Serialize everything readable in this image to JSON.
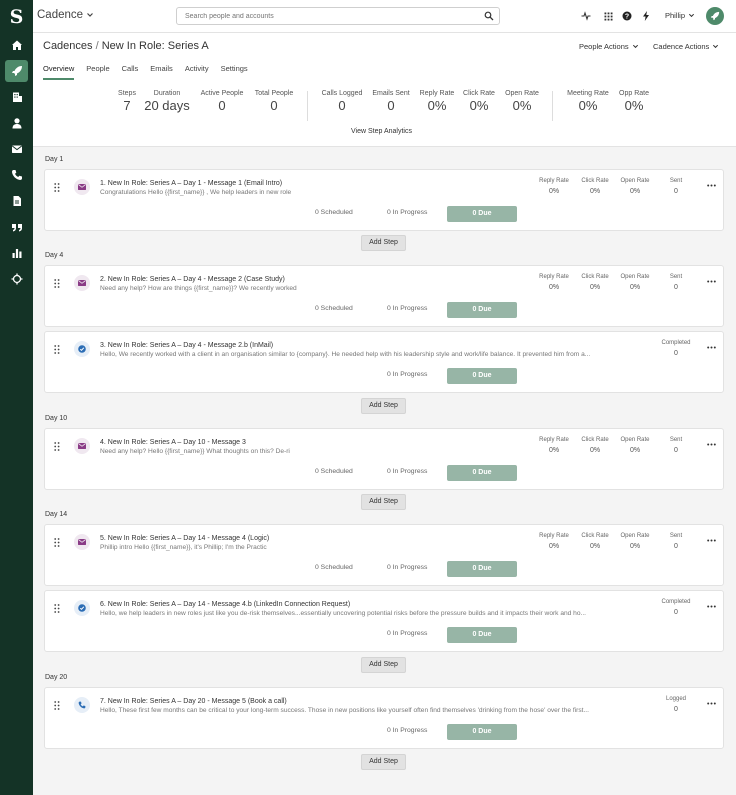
{
  "app": {
    "name": "Cadence",
    "search_placeholder": "Search people and accounts",
    "user_name": "Phillip"
  },
  "sidebar": {
    "logo": "S",
    "items": [
      {
        "name": "home-icon"
      },
      {
        "name": "rocket-icon",
        "active": true
      },
      {
        "name": "building-icon"
      },
      {
        "name": "person-icon"
      },
      {
        "name": "mail-icon"
      },
      {
        "name": "phone-icon"
      },
      {
        "name": "document-icon"
      },
      {
        "name": "quote-icon"
      },
      {
        "name": "bar-chart-icon"
      },
      {
        "name": "crosshair-icon"
      }
    ]
  },
  "header": {
    "crumb_root": "Cadences",
    "crumb_sep": "/",
    "crumb_current": "New In Role: Series A",
    "people_actions": "People Actions",
    "cadence_actions": "Cadence Actions",
    "tabs": [
      "Overview",
      "People",
      "Calls",
      "Emails",
      "Activity",
      "Settings"
    ],
    "stats": [
      {
        "label": "Steps",
        "value": "7"
      },
      {
        "label": "Duration",
        "value": "20 days"
      },
      {
        "label": "Active People",
        "value": "0"
      },
      {
        "label": "Total People",
        "value": "0"
      },
      {
        "label": "Calls Logged",
        "value": "0"
      },
      {
        "label": "Emails Sent",
        "value": "0"
      },
      {
        "label": "Reply Rate",
        "value": "0%"
      },
      {
        "label": "Click Rate",
        "value": "0%"
      },
      {
        "label": "Open Rate",
        "value": "0%"
      },
      {
        "label": "Meeting Rate",
        "value": "0%"
      },
      {
        "label": "Opp Rate",
        "value": "0%"
      }
    ],
    "analytics_link": "View Step Analytics"
  },
  "labels": {
    "reply_rate": "Reply Rate",
    "click_rate": "Click Rate",
    "open_rate": "Open Rate",
    "sent": "Sent",
    "completed": "Completed",
    "logged": "Logged",
    "add_step": "Add Step"
  },
  "days": [
    "Day 1",
    "Day 4",
    "Day 10",
    "Day 14",
    "Day 20"
  ],
  "steps": [
    {
      "title": "1. New In Role: Series A – Day 1 - Message 1 (Email Intro)",
      "preview": "Congratulations Hello {{first_name}} , We help leaders in new role",
      "reply": "0%",
      "click": "0%",
      "open": "0%",
      "sent": "0",
      "scheduled": "0 Scheduled",
      "in_progress": "0 In Progress",
      "due": "0 Due"
    },
    {
      "title": "2. New In Role: Series A – Day 4 - Message 2 (Case Study)",
      "preview": "Need any help? How are things {{first_name}}? We recently worked",
      "reply": "0%",
      "click": "0%",
      "open": "0%",
      "sent": "0",
      "scheduled": "0 Scheduled",
      "in_progress": "0 In Progress",
      "due": "0 Due"
    },
    {
      "title": "3. New In Role: Series A – Day 4 - Message 2.b (InMail)",
      "preview": "Hello, We recently worked with a client in an organisation similar to {company}. He needed help with his leadership style and work/life balance. It prevented him from a...",
      "completed": "0",
      "in_progress": "0 In Progress",
      "due": "0 Due"
    },
    {
      "title": "4. New In Role: Series A – Day 10 - Message 3",
      "preview": "Need any help? Hello {{first_name}} What thoughts on this?  De-ri",
      "reply": "0%",
      "click": "0%",
      "open": "0%",
      "sent": "0",
      "scheduled": "0 Scheduled",
      "in_progress": "0 In Progress",
      "due": "0 Due"
    },
    {
      "title": "5. New In Role: Series A – Day 14 - Message 4 (Logic)",
      "preview": "Phillip intro Hello {{first_name}}, it's Phillip; I'm the Practic",
      "reply": "0%",
      "click": "0%",
      "open": "0%",
      "sent": "0",
      "scheduled": "0 Scheduled",
      "in_progress": "0 In Progress",
      "due": "0 Due"
    },
    {
      "title": "6. New In Role: Series A – Day 14 - Message 4.b (LinkedIn Connection Request)",
      "preview": "Hello, we help leaders in new roles just like you de-risk themselves...essentially uncovering potential risks before the pressure builds and it impacts their work and ho...",
      "completed": "0",
      "in_progress": "0 In Progress",
      "due": "0 Due"
    },
    {
      "title": "7. New In Role: Series A – Day 20 - Message 5 (Book a call)",
      "preview": "Hello, These first few months can be critical to your long-term success. Those in new positions like yourself often find themselves 'drinking from the hose' over the first...",
      "logged": "0",
      "in_progress": "0 In Progress",
      "due": "0 Due"
    }
  ]
}
